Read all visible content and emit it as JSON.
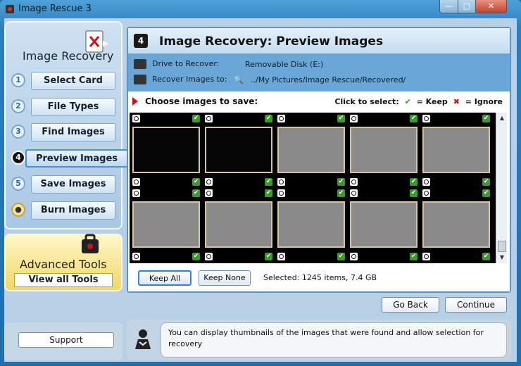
{
  "window": {
    "title": "Image Rescue 3",
    "minimize_label": "—",
    "maximize_label": "□",
    "close_label": "✕"
  },
  "sidebar": {
    "title": "Image Recovery",
    "steps": [
      {
        "num": "1",
        "label": "Select Card"
      },
      {
        "num": "2",
        "label": "File Types"
      },
      {
        "num": "3",
        "label": "Find Images"
      },
      {
        "num": "4",
        "label": "Preview Images"
      },
      {
        "num": "5",
        "label": "Save Images"
      },
      {
        "num": "",
        "label": "Burn Images"
      }
    ],
    "active_step": "4"
  },
  "advanced": {
    "title": "Advanced Tools",
    "button": "View all Tools"
  },
  "main": {
    "step_badge": "4",
    "title": "Image Recovery: Preview Images",
    "drive_label": "Drive to Recover:",
    "drive_value": "Removable Disk (E:)",
    "recover_label": "Recover Images to:",
    "recover_value": "../My Pictures/Image Rescue/Recovered/",
    "choose_label": "Choose images to save:",
    "legend_prefix": "Click to select:",
    "legend_keep": "= Keep",
    "legend_ignore": "= Ignore",
    "keep_all": "Keep All",
    "keep_none": "Keep None",
    "selected": "Selected: 1245 items, 7.4 GB"
  },
  "thumbnails": [
    {
      "kind": "dark"
    },
    {
      "kind": "dark"
    },
    {
      "kind": "gray"
    },
    {
      "kind": "gray"
    },
    {
      "kind": "gray"
    },
    {
      "kind": "gray"
    },
    {
      "kind": "gray"
    },
    {
      "kind": "gray"
    },
    {
      "kind": "gray"
    },
    {
      "kind": "gray"
    }
  ],
  "nav": {
    "back": "Go Back",
    "continue": "Continue"
  },
  "support": {
    "label": "Support"
  },
  "help": {
    "text": "You can display thumbnails of the images that were found and allow selection for recovery"
  },
  "colors": {
    "accent": "#3b7ed6",
    "keep": "#3a9a2b",
    "ignore": "#c8161d"
  }
}
